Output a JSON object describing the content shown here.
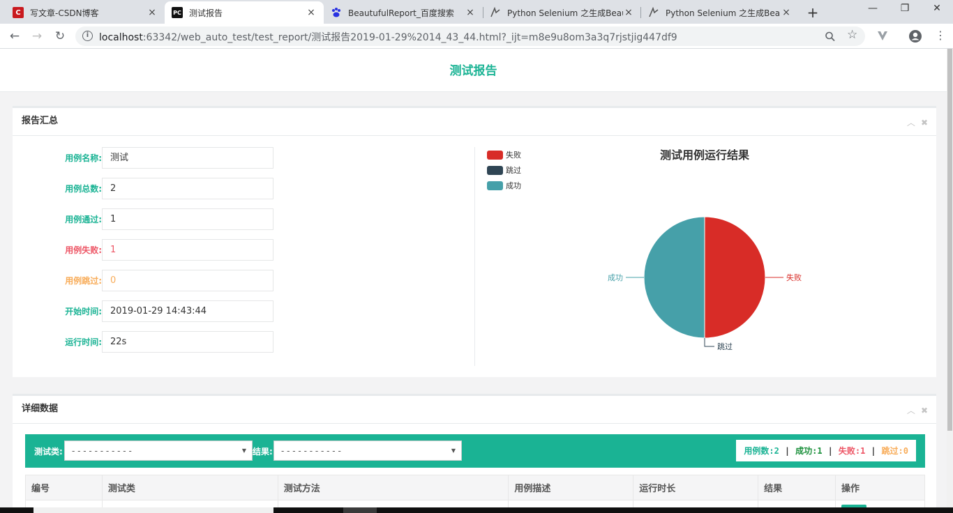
{
  "browser": {
    "tabs": [
      {
        "title": "写文章-CSDN博客",
        "fav": "C",
        "fav_color": "#c9191e",
        "close": "×"
      },
      {
        "title": "测试报告",
        "fav": "PC",
        "fav_color": "#111111",
        "close": "×"
      },
      {
        "title": "BeautufulReport_百度搜索",
        "fav": "baidu-paw-icon",
        "fav_color": "#2932e1",
        "close": "×"
      },
      {
        "title": "Python Selenium 之生成Beau",
        "fav": "ia-icon",
        "fav_color": "#555555",
        "close": "×"
      },
      {
        "title": "Python Selenium 之生成Beau",
        "fav": "ia-icon",
        "fav_color": "#555555",
        "close": "×"
      }
    ],
    "new_tab": "+",
    "window_controls": {
      "minimize": "—",
      "restore": "❐",
      "close": "✕"
    },
    "nav": {
      "back": "←",
      "forward": "→",
      "reload": "↻"
    },
    "url_host": "localhost",
    "url_rest": ":63342/web_auto_test/test_report/测试报告2019-01-29%2014_43_44.html?_ijt=m8e9u8om3a3q7rjstjig447df9",
    "icons": {
      "zoom": "search-icon",
      "star": "star-icon",
      "ext": "extension-icon",
      "profile": "account-icon",
      "menu": "kebab-menu-icon"
    }
  },
  "page": {
    "title": "测试报告"
  },
  "summary": {
    "panel_title": "报告汇总",
    "rows": [
      {
        "label": "用例名称:",
        "value": "测试",
        "color": "#1ab394",
        "value_color": "#333333"
      },
      {
        "label": "用例总数:",
        "value": "2",
        "color": "#1ab394",
        "value_color": "#333333"
      },
      {
        "label": "用例通过:",
        "value": "1",
        "color": "#1ab394",
        "value_color": "#333333"
      },
      {
        "label": "用例失败:",
        "value": "1",
        "color": "#ed5565",
        "value_color": "#ed5565"
      },
      {
        "label": "用例跳过:",
        "value": "0",
        "color": "#f8ac59",
        "value_color": "#f8ac59"
      },
      {
        "label": "开始时间:",
        "value": "2019-01-29 14:43:44",
        "color": "#1ab394",
        "value_color": "#333333"
      },
      {
        "label": "运行时间:",
        "value": "22s",
        "color": "#1ab394",
        "value_color": "#333333"
      }
    ]
  },
  "chart_data": {
    "type": "pie",
    "title": "测试用例运行结果",
    "legend_position": "top-left",
    "slices": [
      {
        "name": "失败",
        "value": 1,
        "color": "#d82c27"
      },
      {
        "name": "跳过",
        "value": 0,
        "color": "#2f4554"
      },
      {
        "name": "成功",
        "value": 1,
        "color": "#46a0a9"
      }
    ]
  },
  "detail": {
    "panel_title": "详细数据",
    "filter_class_label": "测试类:",
    "filter_class_value": "- - - - - - - - - - -",
    "filter_result_label": "结果:",
    "filter_result_value": "- - - - - - - - - - -",
    "counts": {
      "total_label": "用例数:",
      "total": "2",
      "pass_label": "成功:",
      "pass": "1",
      "fail_label": "失败:",
      "fail": "1",
      "skip_label": "跳过:",
      "skip": "0",
      "sep": "|"
    },
    "columns": [
      "编号",
      "测试类",
      "测试方法",
      "用例描述",
      "运行时长",
      "结果",
      "操作"
    ]
  },
  "colors": {
    "accent": "#1ab394",
    "danger": "#ed5565",
    "warning": "#f8ac59"
  }
}
